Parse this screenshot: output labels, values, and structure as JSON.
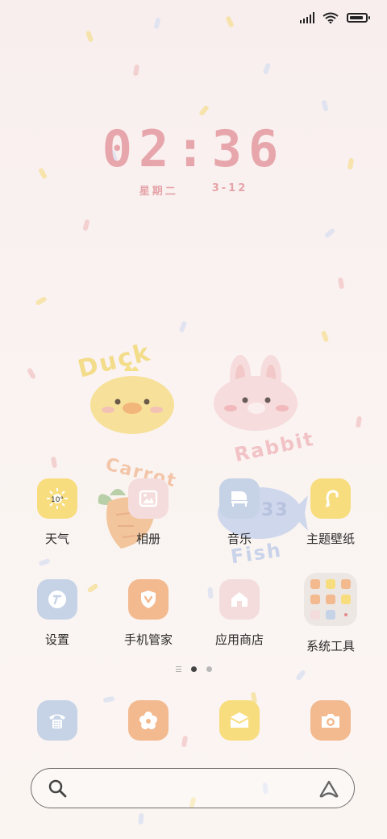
{
  "clock": {
    "time": "02:36",
    "weekday": "星期二",
    "date": "3-12"
  },
  "statusbar": {
    "battery_level": 0.9
  },
  "wallpaper": {
    "duck_text": "Duck",
    "rabbit_text": "Rabbit",
    "carrot_text": "Carrot",
    "fish_text": "Fish",
    "fish_number": "33"
  },
  "apps": [
    {
      "label": "天气",
      "icon": "weather-icon",
      "color": "#f8dd7f",
      "temp": "10°"
    },
    {
      "label": "相册",
      "icon": "gallery-icon",
      "color": "#f4dcdc"
    },
    {
      "label": "音乐",
      "icon": "piano-icon",
      "color": "#c6d3e6"
    },
    {
      "label": "主题壁纸",
      "icon": "theme-brush-icon",
      "color": "#f8dd7f"
    },
    {
      "label": "设置",
      "icon": "settings-icon",
      "color": "#c6d3e6"
    },
    {
      "label": "手机管家",
      "icon": "shield-icon",
      "color": "#f3b98f"
    },
    {
      "label": "应用商店",
      "icon": "store-icon",
      "color": "#f4dcdc"
    },
    {
      "label": "系统工具",
      "icon": "folder-icon",
      "color": "#ede7e4"
    }
  ],
  "dock": [
    {
      "icon": "phone-icon",
      "color": "#c6d3e6"
    },
    {
      "icon": "flower-icon",
      "color": "#f3b98f"
    },
    {
      "icon": "message-icon",
      "color": "#f8dd7f"
    },
    {
      "icon": "camera-icon",
      "color": "#f3b98f"
    }
  ],
  "pager": {
    "pages": 2,
    "current": 1
  }
}
